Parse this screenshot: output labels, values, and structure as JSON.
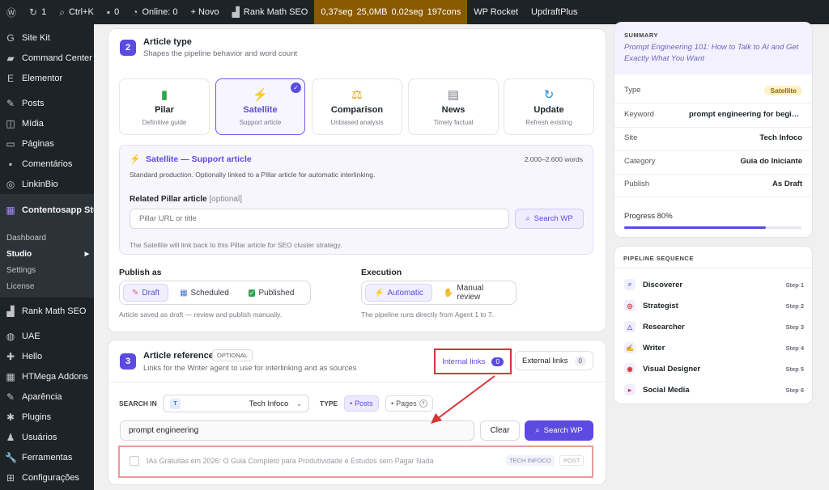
{
  "adminbar": {
    "updates": "1",
    "search": "Ctrl+K",
    "comments": "0",
    "online": "Online: 0",
    "new": "+ Novo",
    "rankmath": "Rank Math SEO",
    "perf": [
      "0,37seg",
      "25,0MB",
      "0,02seg",
      "197cons"
    ],
    "wprocket": "WP Rocket",
    "updraft": "UpdraftPlus"
  },
  "sidebar": {
    "items": [
      {
        "icon": "G",
        "label": "Site Kit"
      },
      {
        "icon": "▰",
        "label": "Command Center"
      },
      {
        "icon": "E",
        "label": "Elementor"
      },
      {
        "icon": "✎",
        "label": "Posts"
      },
      {
        "icon": "◫",
        "label": "Mídia"
      },
      {
        "icon": "▭",
        "label": "Páginas"
      },
      {
        "icon": "▪",
        "label": "Comentários"
      },
      {
        "icon": "◎",
        "label": "LinkinBio"
      }
    ],
    "current": "Contentosapp Studio",
    "submenu": [
      "Dashboard",
      "Studio",
      "Settings",
      "License"
    ],
    "items2": [
      {
        "icon": "▟",
        "label": "Rank Math SEO"
      },
      {
        "icon": "◍",
        "label": "UAE"
      },
      {
        "icon": "✚",
        "label": "Hello"
      },
      {
        "icon": "▦",
        "label": "HTMega Addons"
      },
      {
        "icon": "✎",
        "label": "Aparência"
      },
      {
        "icon": "✱",
        "label": "Plugins"
      },
      {
        "icon": "♟",
        "label": "Usuários"
      },
      {
        "icon": "🔧",
        "label": "Ferramentas"
      },
      {
        "icon": "⊞",
        "label": "Configurações"
      }
    ]
  },
  "step2": {
    "num": "2",
    "title": "Article type",
    "subtitle": "Shapes the pipeline behavior and word count",
    "types": [
      {
        "icon": "▮",
        "label": "Pilar",
        "desc": "Definitive guide"
      },
      {
        "icon": "⚡",
        "label": "Satellite",
        "desc": "Support article"
      },
      {
        "icon": "⚖",
        "label": "Comparison",
        "desc": "Unbiased analysis"
      },
      {
        "icon": "▤",
        "label": "News",
        "desc": "Timely factual"
      },
      {
        "icon": "↻",
        "label": "Update",
        "desc": "Refresh existing"
      }
    ],
    "panel": {
      "title": "Satellite — Support article",
      "words": "2.000–2.600 words",
      "desc": "Standard production. Optionally linked to a Pillar article for automatic interlinking.",
      "related_label": "Related Pillar article",
      "optional": "[optional]",
      "placeholder": "Pillar URL or title",
      "search_btn": "Search WP",
      "hint": "The Satellite will link back to this Pillar article for SEO cluster strategy."
    },
    "publish": {
      "label": "Publish as",
      "opts": [
        "Draft",
        "Scheduled",
        "Published"
      ],
      "note": "Article saved as draft — review and publish manually."
    },
    "execution": {
      "label": "Execution",
      "opts": [
        "Automatic",
        "Manual review"
      ],
      "note": "The pipeline runs directly from Agent 1 to 7."
    }
  },
  "step3": {
    "num": "3",
    "title": "Article references",
    "badge": "OPTIONAL",
    "subtitle": "Links for the Writer agent to use for interlinking and as sources",
    "tab_internal": "Internal links",
    "internal_count": "0",
    "tab_external": "External links",
    "external_count": "0",
    "search_in": "SEARCH IN",
    "site_initial": "T",
    "site": "Tech Infoco",
    "type_label": "TYPE",
    "type_posts": "Posts",
    "type_pages": "Pages",
    "query": "prompt engineering",
    "clear": "Clear",
    "search_btn": "Search WP",
    "result": {
      "title": "IAs Gratuitas em 2026: O Guia Completo para Produtividade e Estudos sem Pagar Nada",
      "site": "TECH INFOCO",
      "type": "POST"
    }
  },
  "summary": {
    "label": "SUMMARY",
    "title": "Prompt Engineering 101: How to Talk to AI and Get Exactly What You Want",
    "rows": [
      {
        "k": "Type",
        "v": "Satellite"
      },
      {
        "k": "Keyword",
        "v": "prompt engineering for beginners"
      },
      {
        "k": "Site",
        "v": "Tech Infoco"
      },
      {
        "k": "Category",
        "v": "Guia do Iniciante"
      },
      {
        "k": "Publish",
        "v": "As Draft"
      }
    ],
    "progress_label": "Progress 80%",
    "progress": 0.8
  },
  "pipeline": {
    "label": "PIPELINE SEQUENCE",
    "steps": [
      {
        "icon": "⌕",
        "name": "Discoverer",
        "step": "Step 1"
      },
      {
        "icon": "◎",
        "name": "Strategist",
        "step": "Step 2"
      },
      {
        "icon": "△",
        "name": "Researcher",
        "step": "Step 3"
      },
      {
        "icon": "✍",
        "name": "Writer",
        "step": "Step 4"
      },
      {
        "icon": "◉",
        "name": "Visual Designer",
        "step": "Step 5"
      },
      {
        "icon": "▸",
        "name": "Social Media",
        "step": "Step 6"
      }
    ]
  },
  "colors": {
    "accent": "#5b4be0",
    "highlight": "#d63638"
  }
}
